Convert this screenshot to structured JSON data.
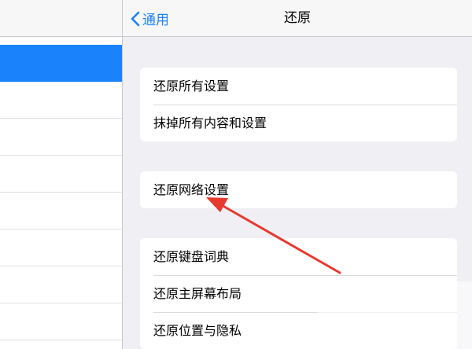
{
  "navbar": {
    "back_label": "通用",
    "title": "还原"
  },
  "groups": [
    {
      "items": [
        "还原所有设置",
        "抹掉所有内容和设置"
      ]
    },
    {
      "items": [
        "还原网络设置"
      ]
    },
    {
      "items": [
        "还原键盘词典",
        "还原主屏幕布局",
        "还原位置与隐私"
      ]
    }
  ],
  "colors": {
    "accent": "#1a82fb",
    "background": "#efeff4",
    "annotation_arrow": "#e8392f"
  },
  "icons": {
    "back": "chevron-left-icon"
  }
}
